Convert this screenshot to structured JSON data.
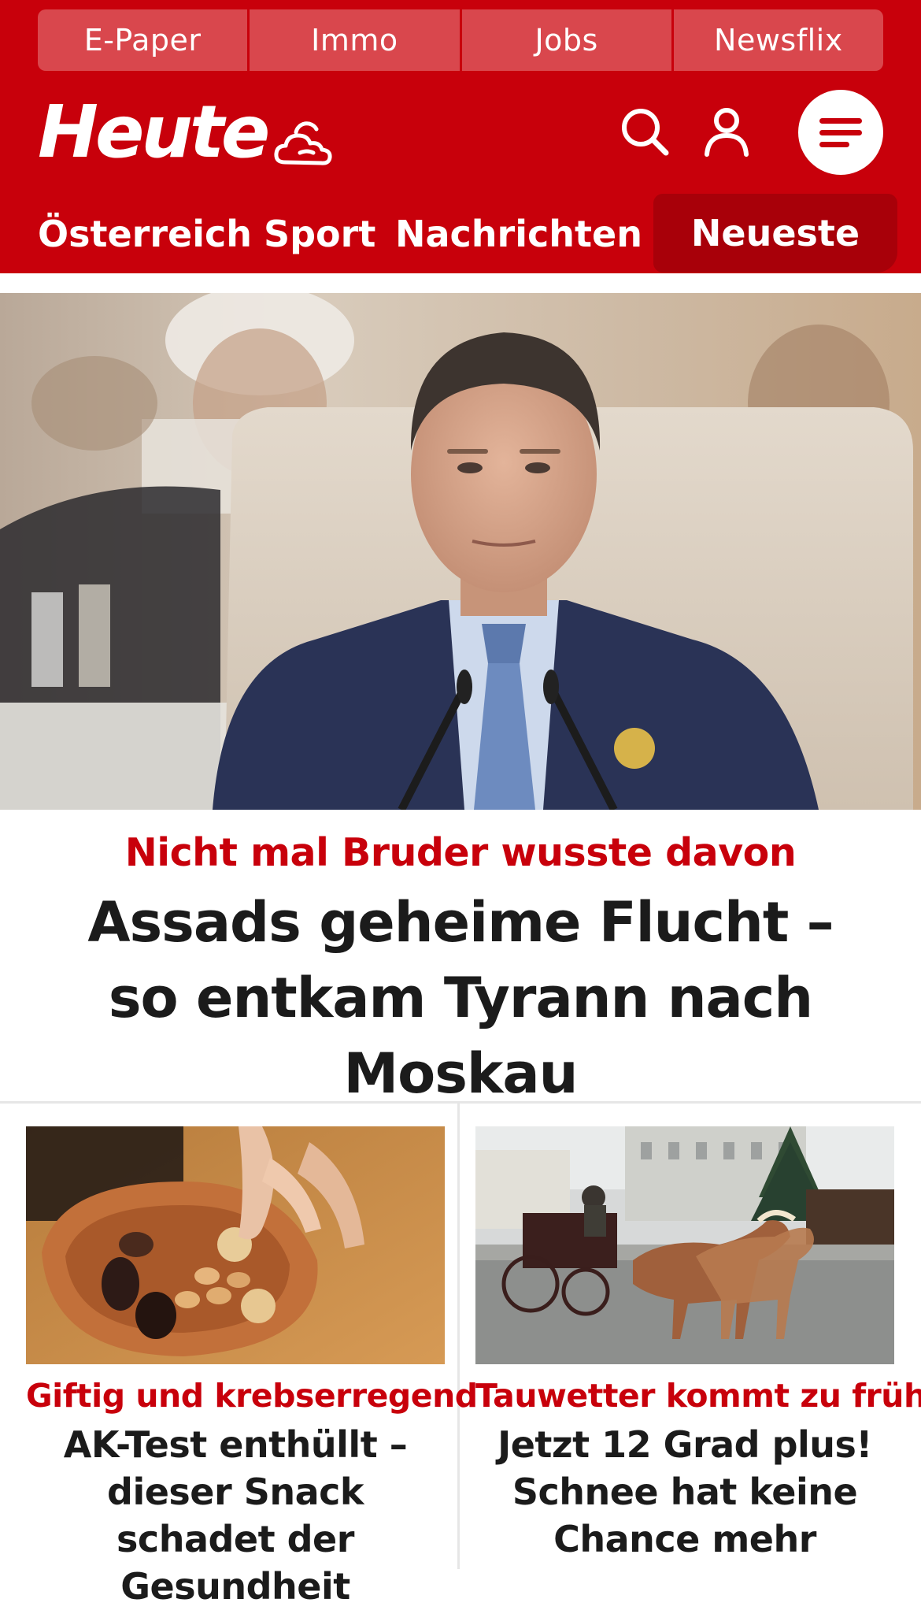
{
  "topbar": {
    "items": [
      "E-Paper",
      "Immo",
      "Jobs",
      "Newsflix"
    ]
  },
  "header": {
    "logo": "Heute",
    "weather_icon": "weather-cloud-sun-icon",
    "search_icon": "search-icon",
    "user_icon": "user-icon",
    "menu_icon": "hamburger-menu-icon"
  },
  "nav": {
    "items": [
      "Österreich",
      "Sport",
      "Nachrichten"
    ],
    "highlight": "Neueste"
  },
  "hero": {
    "kicker": "Nicht mal Bruder wusste davon",
    "title": "Assads geheime Flucht – so entkam Tyrann nach Moskau"
  },
  "cards": [
    {
      "kicker": "Giftig und krebserregend",
      "title": "AK-Test enthüllt – dieser Snack schadet der Gesundheit"
    },
    {
      "kicker": "Tauwetter kommt zu früh",
      "title": "Jetzt 12 Grad plus! Schnee hat keine Chance mehr"
    }
  ],
  "colors": {
    "brand_red": "#c8000b",
    "topbar_item": "#d9474d",
    "nav_highlight": "#a80009",
    "text_dark": "#1b1b1b"
  }
}
